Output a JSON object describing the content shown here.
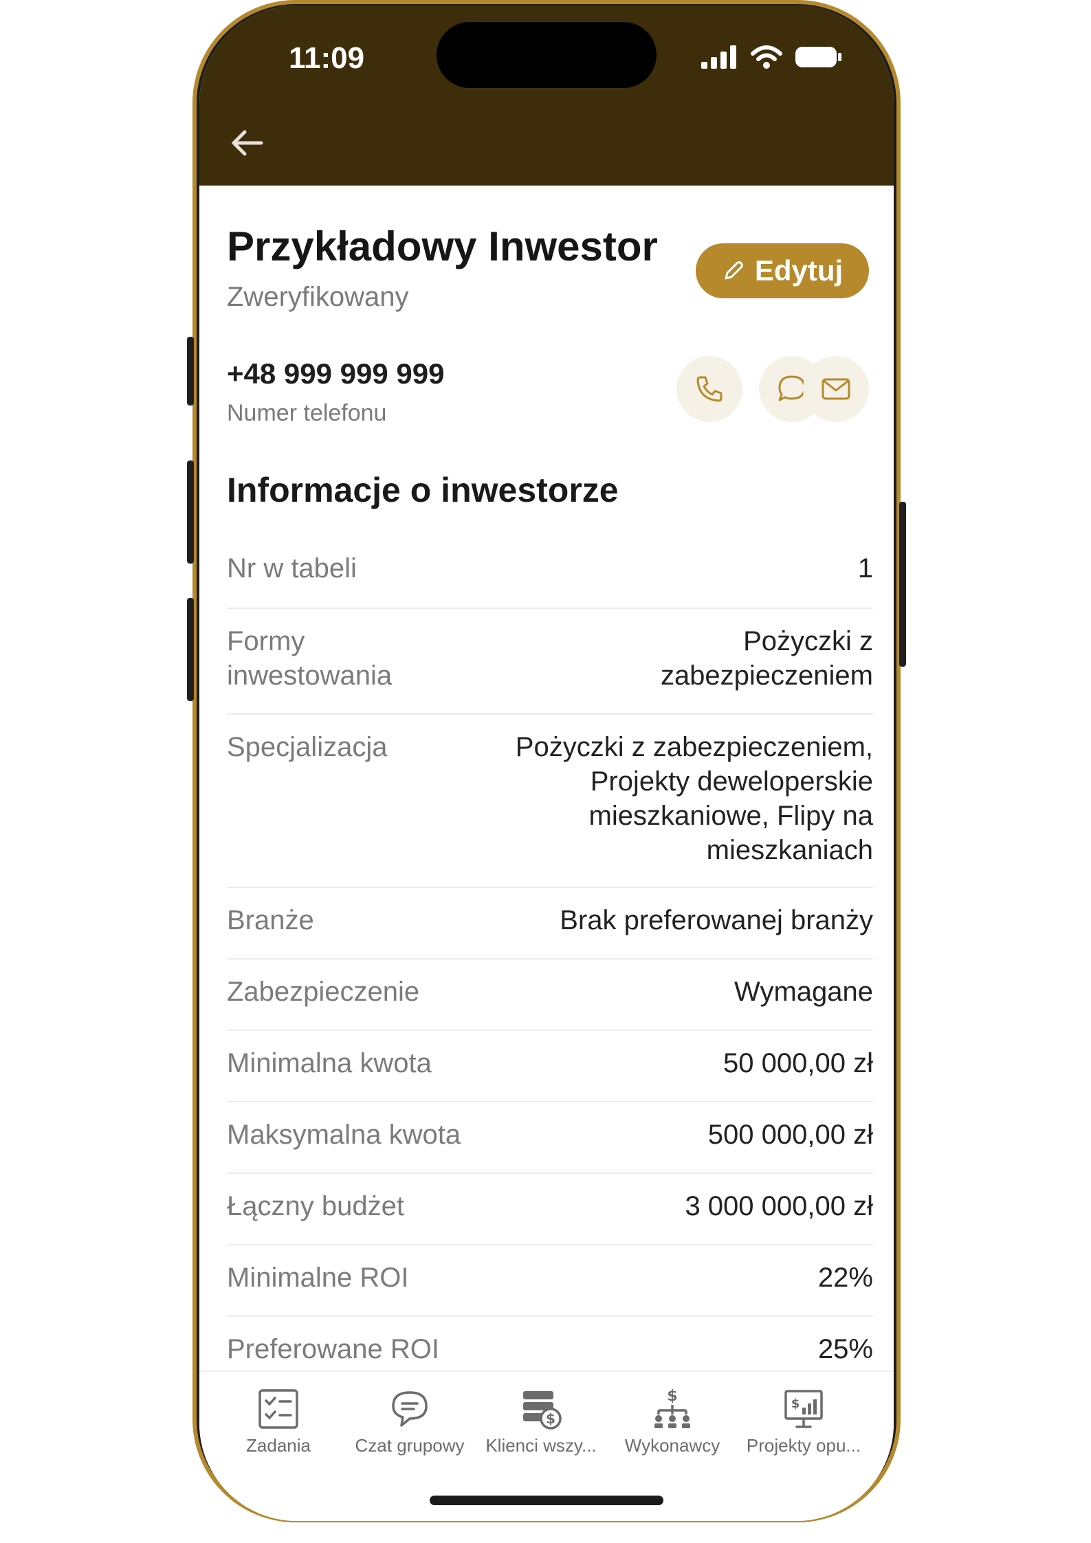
{
  "status_bar": {
    "time": "11:09"
  },
  "header": {
    "name": "Przykładowy Inwestor",
    "status": "Zweryfikowany",
    "edit_label": "Edytuj"
  },
  "contact": {
    "phone": "+48 999 999 999",
    "phone_label": "Numer telefonu"
  },
  "section": {
    "title": "Informacje o inwestorze"
  },
  "info_rows": [
    {
      "label": "Nr w tabeli",
      "value": "1"
    },
    {
      "label": "Formy inwestowania",
      "value": "Pożyczki z zabezpieczeniem"
    },
    {
      "label": "Specjalizacja",
      "value": "Pożyczki z zabezpieczeniem, Projekty deweloperskie mieszkaniowe, Flipy na mieszkaniach"
    },
    {
      "label": "Branże",
      "value": "Brak preferowanej branży"
    },
    {
      "label": "Zabezpieczenie",
      "value": "Wymagane"
    },
    {
      "label": "Minimalna kwota",
      "value": "50 000,00 zł"
    },
    {
      "label": "Maksymalna kwota",
      "value": "500 000,00 zł"
    },
    {
      "label": "Łączny budżet",
      "value": "3 000 000,00 zł"
    },
    {
      "label": "Minimalne ROI",
      "value": "22%"
    },
    {
      "label": "Preferowane ROI",
      "value": "25%"
    }
  ],
  "bottom_nav": [
    {
      "label": "Zadania",
      "icon": "tasks-icon"
    },
    {
      "label": "Czat grupowy",
      "icon": "chat-icon"
    },
    {
      "label": "Klienci wszy...",
      "icon": "clients-icon"
    },
    {
      "label": "Wykonawcy",
      "icon": "contractors-icon"
    },
    {
      "label": "Projekty opu...",
      "icon": "projects-icon"
    }
  ],
  "colors": {
    "topbar": "#3d2d0b",
    "accent": "#b5892c",
    "button_bg": "#f6f1e6"
  }
}
